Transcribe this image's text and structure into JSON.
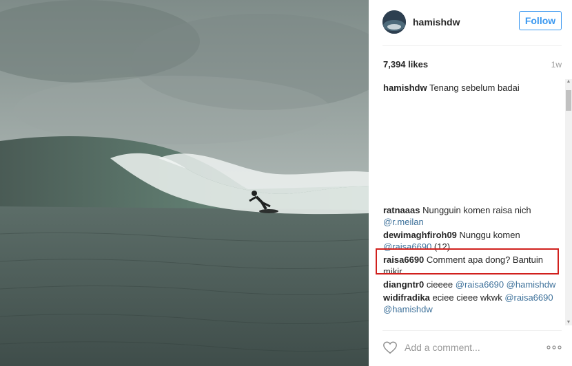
{
  "post": {
    "username": "hamishdw",
    "follow_label": "Follow",
    "likes": "7,394 likes",
    "time": "1w",
    "caption": {
      "user": "hamishdw",
      "text": " Tenang sebelum badai"
    },
    "comments": [
      {
        "user": "ratnaaas",
        "text": " Nungguin komen raisa nich ",
        "mention": "@r.meilan",
        "extra": ""
      },
      {
        "user": "dewimaghfiroh09",
        "text": " Nunggu komen ",
        "mention": "@raisa6690",
        "extra": " (12)"
      },
      {
        "user": "raisa6690",
        "text": " Comment apa dong? Bantuin mikir..",
        "mention": "",
        "extra": ""
      },
      {
        "user": "diangntr0",
        "text": " cieeee ",
        "mention": "@raisa6690 @hamishdw",
        "extra": ""
      },
      {
        "user": "widifradika",
        "text": " eciee cieee wkwk ",
        "mention": "@raisa6690 @hamishdw",
        "extra": ""
      }
    ],
    "add_comment_placeholder": "Add a comment..."
  },
  "icons": {
    "heart": "heart-icon",
    "more": "more-options-icon",
    "avatar": "avatar"
  },
  "colors": {
    "accent": "#3897f0",
    "mention": "#3f729b",
    "highlight": "#d1201d"
  }
}
